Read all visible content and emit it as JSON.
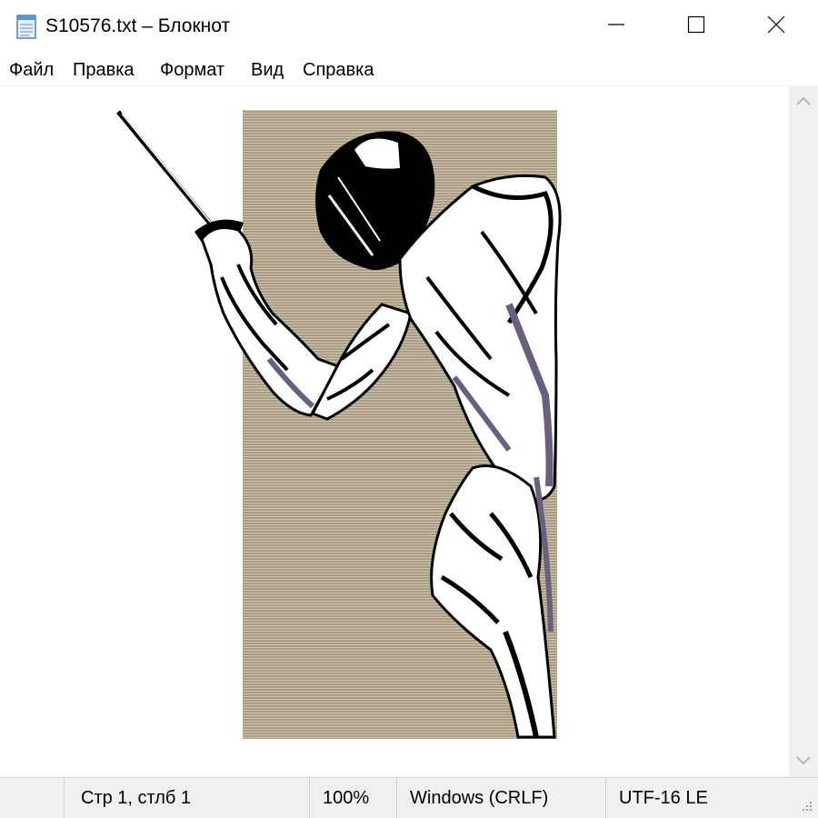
{
  "window": {
    "title": "S10576.txt – Блокнот",
    "icon": "notepad-icon",
    "controls": [
      "minimize-icon",
      "maximize-icon",
      "close-icon"
    ]
  },
  "menu": {
    "items": [
      "Файл",
      "Правка",
      "Формат",
      "Вид",
      "Справка"
    ]
  },
  "editor": {
    "content": "ascii-art-fencer",
    "background_colors": [
      "#b9ae94",
      "#d1c6ab",
      "#a89d84"
    ],
    "ink_color": "#000000",
    "shade_color": "#6b5f80"
  },
  "scrollbar": {
    "up_icon": "chevron-up-icon",
    "down_icon": "chevron-down-icon"
  },
  "status": {
    "position": "Стр 1, стлб 1",
    "zoom": "100%",
    "line_endings": "Windows (CRLF)",
    "encoding": "UTF-16 LE"
  },
  "colors": {
    "chrome_bg": "#f0f0f0",
    "window_bg": "#ffffff",
    "disabled_glyph": "#a0a0a0"
  }
}
